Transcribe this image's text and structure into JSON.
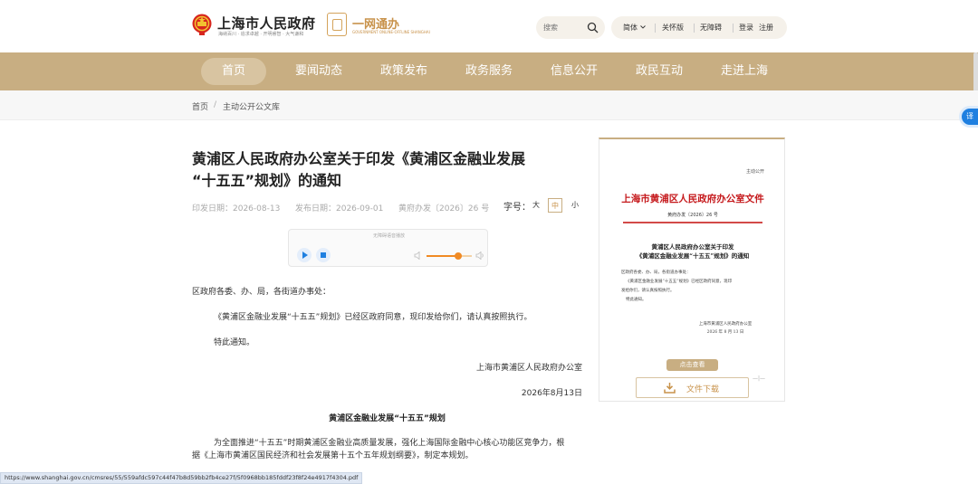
{
  "header": {
    "site_title": "上海市人民政府",
    "site_subtitle": "海纳百川 · 追求卓越 · 开明睿智 · 大气谦和",
    "yiwang_title": "一网通办",
    "yiwang_subtitle": "GOVERNMENT ONLINE-OFFLINE SHANGHAI",
    "search_placeholder": "搜索",
    "tools": {
      "language": "简体",
      "care_mode": "关怀版",
      "accessibility": "无障碍",
      "login": "登录",
      "register": "注册"
    }
  },
  "nav": {
    "items": [
      "首页",
      "要闻动态",
      "政策发布",
      "政务服务",
      "信息公开",
      "政民互动",
      "走进上海"
    ],
    "active_index": 0
  },
  "breadcrumb": {
    "home": "首页",
    "separator": "/",
    "current": "主动公开公文库"
  },
  "side_badge": "译",
  "article": {
    "title_line1": "黄浦区人民政府办公室关于印发《黄浦区金融业发展",
    "title_line2": "“十五五”规划》的通知",
    "print_date": "印发日期：2026-08-13",
    "publish_date": "发布日期：2026-09-01",
    "doc_number": "黄府办发〔2026〕26 号",
    "font_size_label": "字号：",
    "font_sizes": [
      "大",
      "中",
      "小"
    ],
    "font_size_active_index": 1,
    "player_label": "无障碍语音播放",
    "volume_level": 0.7,
    "salutation": "区政府各委、办、局，各街道办事处：",
    "para1": "《黄浦区金融业发展“十五五”规划》已经区政府同意，现印发给你们，请认真按照执行。",
    "para2": "特此通知。",
    "signature": "上海市黄浦区人民政府办公室",
    "sign_date": "2026年8月13日",
    "plan_title": "黄浦区金融业发展“十五五”规划",
    "plan_para1_line1": "为全面推进“十五五”时期黄浦区金融业高质量发展，强化上海国际金融中心核心功能区竞争力，根",
    "plan_para1_line2": "据《上海市黄浦区国民经济和社会发展第十五个五年规划纲要》，制定本规划。"
  },
  "doc_preview": {
    "tag": "主动公开",
    "red_title": "上海市黄浦区人民政府办公室文件",
    "doc_number": "黄府办发〔2026〕26 号",
    "sub_title_line1": "黄浦区人民政府办公室关于印发",
    "sub_title_line2": "《黄浦区金融业发展“十五五”规划》的通知",
    "p1": "区政府各委、办、局，各街道办事处：",
    "p2": "《黄浦区金融业发展“十五五”规划》已经区政府同意，现印",
    "p3": "发给你们，请认真按照执行。",
    "p4": "特此通知。",
    "sign1": "上海市黄浦区人民政府办公室",
    "sign2": "2026 年 8 月 13 日",
    "view_button": "点击查看",
    "download_button": "文件下载",
    "side_mark": "—|—"
  },
  "status_url": "https://www.shanghai.gov.cn/cmsres/55/559afdc597c44f47b8d59bb2fb4ce27f/5f0968bb185fddf23f8f24e4917f4304.pdf",
  "colors": {
    "nav_gold": "#c8ae82",
    "accent_gold": "#c8924a",
    "doc_red": "#c5191c",
    "player_orange": "#f08a24",
    "badge_blue": "#1e7fe0"
  }
}
